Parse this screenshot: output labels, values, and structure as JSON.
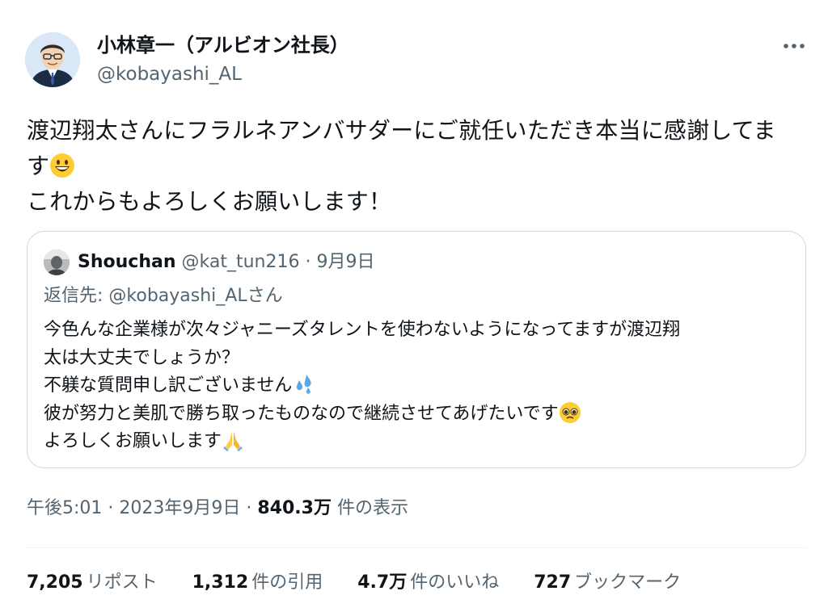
{
  "author": {
    "display_name": "小林章一（アルビオン社長）",
    "handle": "@kobayashi_AL"
  },
  "tweet": {
    "line1": "渡辺翔太さんにフラルネアンバサダーにご就任いただき本当に感謝してま",
    "line2": "す",
    "line3": "これからもよろしくお願いします！"
  },
  "quote": {
    "name": "Shouchan",
    "handle": "@kat_tun216",
    "separator": "·",
    "date": "9月9日",
    "reply_prefix": "返信先: ",
    "reply_handle": "@kobayashi_AL",
    "reply_suffix": "さん",
    "line1": "今色んな企業様が次々ジャニーズタレントを使わないようになってますが渡辺翔",
    "line2": "太は大丈夫でしょうか？",
    "line3": "不躾な質問申し訳ございません",
    "line4": "彼が努力と美肌で勝ち取ったものなので継続させてあげたいです",
    "line5": "よろしくお願いします"
  },
  "meta": {
    "time": "午後5:01",
    "sep1": " · ",
    "date": "2023年9月9日",
    "sep2": " · ",
    "views_count": "840.3万",
    "views_label": " 件の表示"
  },
  "stats": [
    {
      "count": "7,205",
      "label": "リポスト"
    },
    {
      "count": "1,312",
      "label": "件の引用"
    },
    {
      "count": "4.7万",
      "label": "件のいいね"
    },
    {
      "count": "727",
      "label": "ブックマーク"
    }
  ],
  "icons": {
    "more": "more-horizontal-icon",
    "grin": "grinning-face-emoji",
    "sweat": "sweat-droplets-emoji",
    "pleading": "pleading-face-emoji",
    "pray": "folded-hands-emoji"
  },
  "colors": {
    "text": "#0f1419",
    "secondary": "#536471",
    "border": "#cfd9de"
  }
}
